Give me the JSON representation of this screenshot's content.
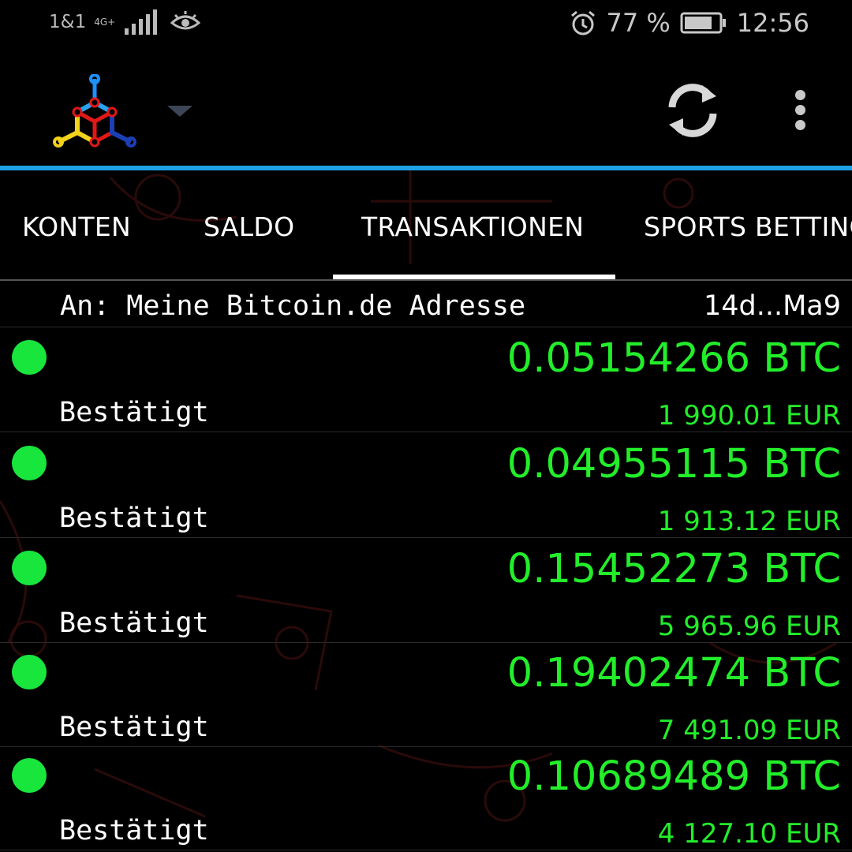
{
  "status_bar": {
    "carrier": "1&1",
    "network": "4G+",
    "battery_percent": "77 %",
    "time": "12:56",
    "icons": [
      "signal-icon",
      "eye-comfort-icon",
      "alarm-icon",
      "battery-icon"
    ]
  },
  "app_bar": {
    "logo_icon": "mycelium-logo-icon",
    "dropdown_icon": "dropdown-arrow-icon",
    "refresh_icon": "sync-icon",
    "menu_icon": "overflow-menu-icon",
    "accent_color": "#1ea1e4"
  },
  "tabs": [
    {
      "label": "KONTEN"
    },
    {
      "label": "SALDO"
    },
    {
      "label": "TRANSAKTIONEN",
      "active": true
    },
    {
      "label": "SPORTS BETTING"
    }
  ],
  "list_header": {
    "to_label": "An: Meine Bitcoin.de Adresse",
    "address": "14d...Ma9"
  },
  "transactions": [
    {
      "btc": "0.05154266 BTC",
      "status": "Bestätigt",
      "eur": "1 990.01 EUR"
    },
    {
      "btc": "0.04955115 BTC",
      "status": "Bestätigt",
      "eur": "1 913.12 EUR"
    },
    {
      "btc": "0.15452273 BTC",
      "status": "Bestätigt",
      "eur": "5 965.96 EUR"
    },
    {
      "btc": "0.19402474 BTC",
      "status": "Bestätigt",
      "eur": "7 491.09 EUR"
    },
    {
      "btc": "0.10689489 BTC",
      "status": "Bestätigt",
      "eur": "4 127.10 EUR"
    }
  ],
  "colors": {
    "amount_green": "#22ee2a",
    "confirmed_dot": "#18e63c"
  }
}
